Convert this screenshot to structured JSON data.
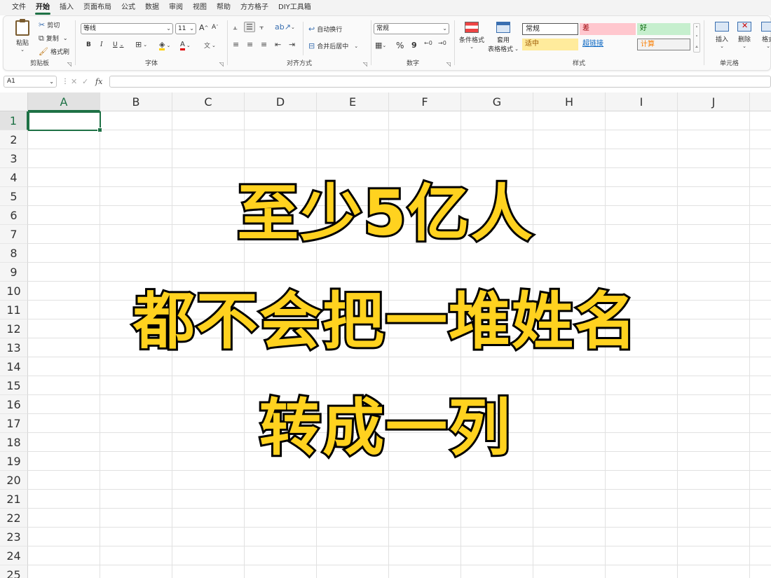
{
  "menu": {
    "tabs": [
      "文件",
      "开始",
      "插入",
      "页面布局",
      "公式",
      "数据",
      "审阅",
      "视图",
      "帮助",
      "方方格子",
      "DIY工具箱"
    ],
    "active_tab": "开始"
  },
  "ribbon": {
    "clipboard": {
      "paste": "粘贴",
      "cut": "剪切",
      "copy": "复制",
      "format_painter": "格式刷",
      "label": "剪贴板"
    },
    "font": {
      "font_name": "等线",
      "font_size": "11",
      "bold": "B",
      "italic": "I",
      "underline": "U",
      "grow": "A",
      "shrink": "A",
      "font_color": "A",
      "phonetic": "文",
      "label": "字体"
    },
    "alignment": {
      "wrap_text": "自动换行",
      "merge_center": "合并后居中",
      "label": "对齐方式"
    },
    "number": {
      "format": "常规",
      "percent": "%",
      "comma": "9",
      "label": "数字"
    },
    "styles": {
      "conditional": "条件格式",
      "table_format_1": "套用",
      "table_format_2": "表格格式",
      "cells": [
        {
          "text": "常规",
          "bg": "#ffffff",
          "color": "#222222"
        },
        {
          "text": "差",
          "bg": "#ffc7ce",
          "color": "#9c0006"
        },
        {
          "text": "好",
          "bg": "#c6efce",
          "color": "#006100"
        },
        {
          "text": "适中",
          "bg": "#ffeb9c",
          "color": "#9c5700"
        },
        {
          "text": "超链接",
          "bg": "#fafafa",
          "color": "#0563c1"
        },
        {
          "text": "计算",
          "bg": "#f2f2f2",
          "color": "#fa7d00"
        }
      ],
      "label": "样式"
    },
    "cells_group": {
      "insert": "插入",
      "delete": "删除",
      "format": "格式",
      "label": "单元格"
    }
  },
  "formula_bar": {
    "name_box": "A1",
    "fx": "fx",
    "value": ""
  },
  "grid": {
    "columns": [
      "A",
      "B",
      "C",
      "D",
      "E",
      "F",
      "G",
      "H",
      "I",
      "J"
    ],
    "rows": [
      "1",
      "2",
      "3",
      "4",
      "5",
      "6",
      "7",
      "8",
      "9",
      "10",
      "11",
      "12",
      "13",
      "14",
      "15",
      "16",
      "17",
      "18",
      "19",
      "20",
      "21",
      "22",
      "23",
      "24",
      "25"
    ],
    "active_cell": "A1"
  },
  "overlay": {
    "line1": "至少5亿人",
    "line2": "都不会把一堆姓名",
    "line3": "转成一列",
    "text_color": "#ffd21f",
    "stroke_color": "#000000"
  },
  "colors": {
    "accent": "#1e7145"
  }
}
